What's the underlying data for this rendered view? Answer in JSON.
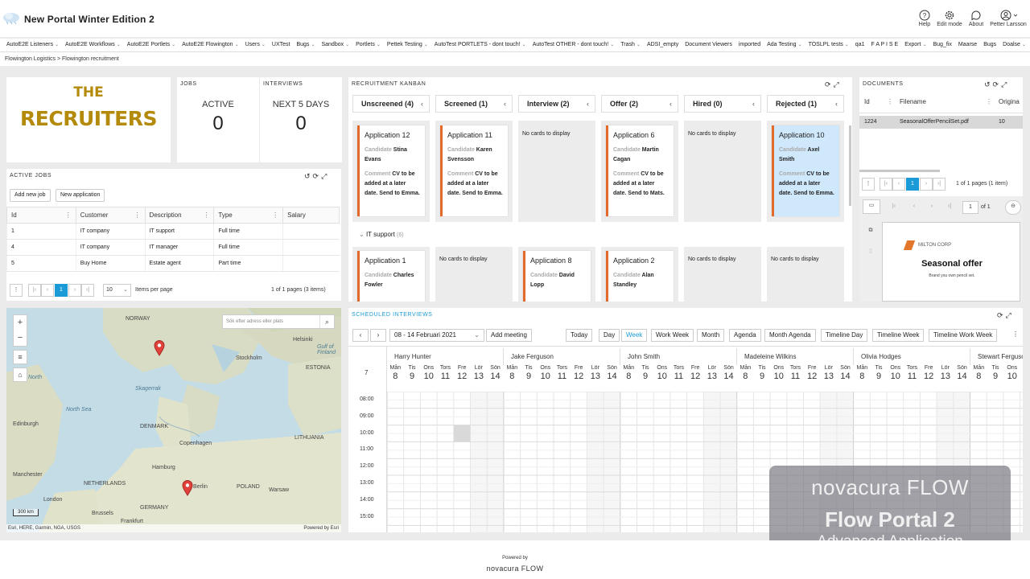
{
  "header": {
    "title": "New Portal Winter Edition 2",
    "actions": {
      "help": "Help",
      "edit_mode": "Edit mode",
      "about": "About",
      "user": "Petter Larsson"
    }
  },
  "nav": [
    "AutoE2E Listeners",
    "AutoE2E Workflows",
    "AutoE2E Portlets",
    "AutoE2E Flowington",
    "Users",
    "UXTest",
    "Bugs",
    "Sandbox",
    "Portlets",
    "Pettek Testing",
    "AutoTest PORTLETS - dont touch!",
    "AutoTest OTHER - dont touch!",
    "Trash",
    "ADSI_empty",
    "Document Viewers",
    "imported",
    "Ada Testing",
    "TOSLPL tests",
    "qa1",
    "F A P I S E",
    "Export",
    "Bug_fix",
    "Maarse",
    "Bugs",
    "Doalse",
    "F"
  ],
  "breadcrumb": {
    "a": "Flowington Logistics",
    "sep": ">",
    "b": "Flowington recruitment"
  },
  "brand": {
    "line1": "THE",
    "line2": "RECRUITERS"
  },
  "jobs_kpi": {
    "title": "JOBS",
    "label": "ACTIVE",
    "value": "0"
  },
  "interviews_kpi": {
    "title": "INTERVIEWS",
    "label": "NEXT 5 DAYS",
    "value": "0"
  },
  "active_jobs": {
    "title": "ACTIVE JOBS",
    "add_job": "Add new job",
    "new_application": "New application",
    "columns": [
      "Id",
      "Customer",
      "Description",
      "Type",
      "Salary"
    ],
    "rows": [
      [
        "1",
        "IT company",
        "IT support",
        "Full time",
        ""
      ],
      [
        "4",
        "IT company",
        "IT manager",
        "Full time",
        ""
      ],
      [
        "5",
        "Buy Home",
        "Estate agent",
        "Part time",
        ""
      ]
    ],
    "page": "1",
    "page_size": "10",
    "items_per_page": "Items per page",
    "summary": "1 of 1 pages (3 items)"
  },
  "map": {
    "search_placeholder": "Sök efter adress eller plats",
    "scale": "300 km",
    "attribution": "Esri, HERE, Garmin, NGA, USGS",
    "powered": "Powered by Esri",
    "labels": [
      "NORWAY",
      "Helsinki",
      "Gulf of Finland",
      "ESTONIA",
      "Stockholm",
      "North",
      "Skagerrak",
      "North Sea",
      "Edinburgh",
      "DENMARK",
      "Copenhagen",
      "LITHUANIA",
      "Hamburg",
      "Manchester",
      "NETHERLANDS",
      "London",
      "Brussels",
      "POLAND",
      "Warsaw",
      "GERMANY",
      "Frankfurt",
      "Berlin"
    ]
  },
  "kanban": {
    "title": "RECRUITMENT KANBAN",
    "columns": [
      "Unscreened (4)",
      "Screened (1)",
      "Interview (2)",
      "Offer (2)",
      "Hired (0)",
      "Rejected (1)"
    ],
    "candidate_label": "Candidate",
    "comment_label": "Comment",
    "empty": "No cards to display",
    "cards": [
      {
        "title": "Application 12",
        "candidate": "Stina Evans",
        "comment": "CV to be added at a later date. Send to Emma."
      },
      {
        "title": "Application 11",
        "candidate": "Karen Svensson",
        "comment": "CV to be added at a later date. Send to Emma."
      },
      {
        "title": "Application 6",
        "candidate": "Martin Cagan",
        "comment": "CV to be added at a later date. Send to Mats."
      },
      {
        "title": "Application 10",
        "candidate": "Axel Smith",
        "comment": "CV to be added at a later date. Send to Emma."
      }
    ],
    "group": "IT support",
    "group_count": "(6)",
    "cards2": [
      {
        "title": "Application 1",
        "candidate": "Charles Fowler"
      },
      {
        "title": "Application 8",
        "candidate": "David Lopp"
      },
      {
        "title": "Application 2",
        "candidate": "Alan Standley"
      }
    ]
  },
  "documents": {
    "title": "DOCUMENTS",
    "columns": [
      "Id",
      "Filename",
      "Origina"
    ],
    "row": [
      "1224",
      "SeasonalOfferPencilSet.pdf",
      "10"
    ],
    "page": "1",
    "summary": "1 of 1 pages (1 item)",
    "viewer_page": "1",
    "viewer_of": "of 1",
    "preview_company": "MILTON CORP",
    "preview_title": "Seasonal offer",
    "preview_sub": "Brand you own pencil set."
  },
  "schedule": {
    "title": "SCHEDULED INTERVIEWS",
    "range": "08 - 14 Februari 2021",
    "add_meeting": "Add meeting",
    "today": "Today",
    "views": [
      "Day",
      "Week",
      "Work Week",
      "Month",
      "Agenda",
      "Month Agenda",
      "Timeline Day",
      "Timeline Week",
      "Timeline Work Week"
    ],
    "week_no": "7",
    "people": [
      "Harry Hunter",
      "Jake Ferguson",
      "John Smith",
      "Madeleine Wilkins",
      "Olivia Hodges",
      "Stewart Ferguson"
    ],
    "days": [
      "Mån",
      "Tis",
      "Ons",
      "Tors",
      "Fre",
      "Lör",
      "Sön"
    ],
    "dates": [
      "8",
      "9",
      "10",
      "11",
      "12",
      "13",
      "14"
    ],
    "times": [
      "08:00",
      "09:00",
      "10:00",
      "11:00",
      "12:00",
      "13:00",
      "14:00",
      "15:00"
    ]
  },
  "watermark": {
    "brand": "novacura FLOW",
    "product": "Flow Portal 2",
    "sub": "Advanced Application"
  },
  "footer": {
    "powered": "Powered by",
    "brand": "novacura FLOW"
  }
}
